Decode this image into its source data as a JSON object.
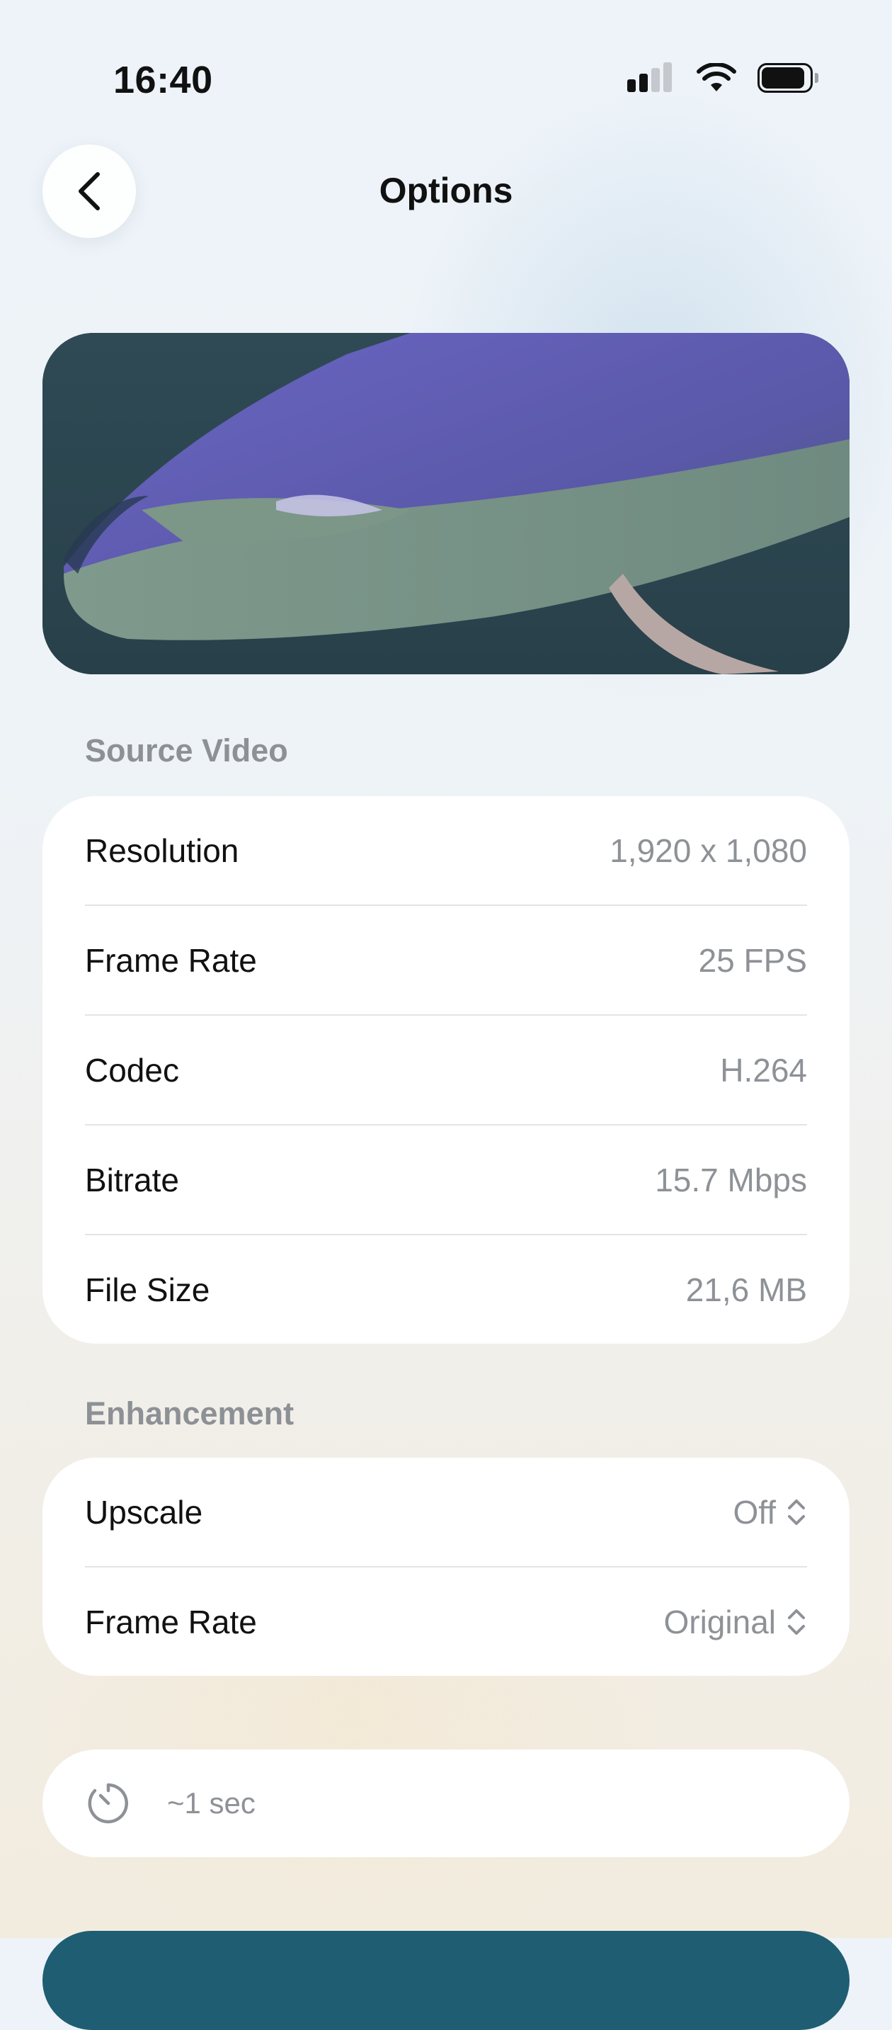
{
  "status_bar": {
    "time": "16:40"
  },
  "header": {
    "title": "Options"
  },
  "source_video": {
    "section_title": "Source Video",
    "rows": [
      {
        "label": "Resolution",
        "value": "1,920 x 1,080"
      },
      {
        "label": "Frame Rate",
        "value": "25 FPS"
      },
      {
        "label": "Codec",
        "value": "H.264"
      },
      {
        "label": "Bitrate",
        "value": "15.7 Mbps"
      },
      {
        "label": "File Size",
        "value": "21,6 MB"
      }
    ]
  },
  "enhancement": {
    "section_title": "Enhancement",
    "rows": [
      {
        "label": "Upscale",
        "value": "Off"
      },
      {
        "label": "Frame Rate",
        "value": "Original"
      }
    ]
  },
  "estimate": {
    "text": "~1 sec",
    "icon": "timer-icon"
  },
  "icons": {
    "back": "chevron-left-icon",
    "picker": "chevron-up-down-icon"
  },
  "colors": {
    "value_gray": "#8e9196",
    "section_gray": "#8d9196",
    "primary_button": "#1f5d72"
  }
}
